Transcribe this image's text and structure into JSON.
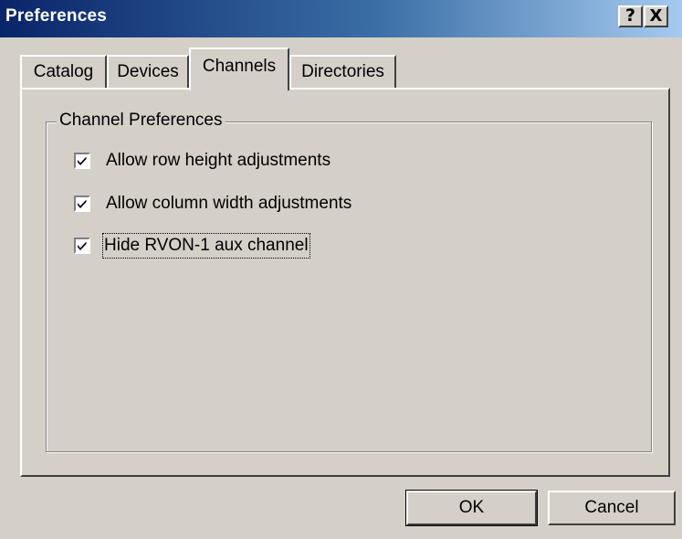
{
  "window": {
    "title": "Preferences",
    "help_glyph": "?",
    "close_glyph": "X"
  },
  "tabs": [
    {
      "label": "Catalog",
      "active": false
    },
    {
      "label": "Devices",
      "active": false
    },
    {
      "label": "Channels",
      "active": true
    },
    {
      "label": "Directories",
      "active": false
    }
  ],
  "group": {
    "legend": "Channel Preferences",
    "options": [
      {
        "label": "Allow row height adjustments",
        "checked": true
      },
      {
        "label": "Allow column width adjustments",
        "checked": true
      },
      {
        "label": "Hide RVON-1 aux channel",
        "checked": true,
        "focused": true
      }
    ]
  },
  "buttons": {
    "ok_label": "OK",
    "cancel_label": "Cancel"
  },
  "icons": {
    "help": "question-mark-icon",
    "close": "close-icon",
    "check": "checkmark-icon"
  }
}
